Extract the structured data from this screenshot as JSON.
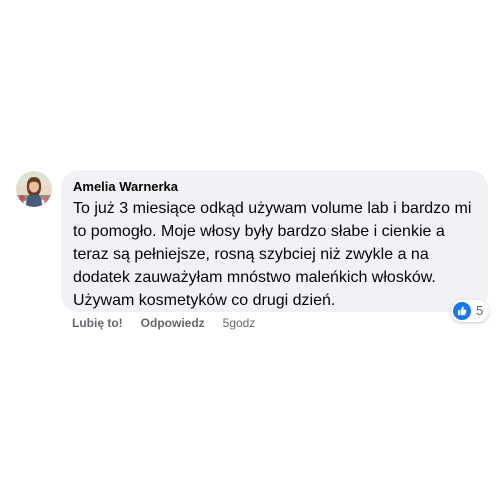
{
  "comment": {
    "author": "Amelia Warnerka",
    "text_lines": [
      "To już 3 miesiące odkąd używam volume lab i bardzo mi",
      "to pomogło. Moje włosy były bardzo słabe i cienkie a",
      "teraz są pełniejsze, rosną szybciej niż zwykle a na",
      "dodatek zauważyłam mnóstwo maleńkich włosków.",
      "Używam kosmetyków co drugi dzień."
    ],
    "reaction": {
      "icon": "like-icon",
      "count": "5"
    },
    "actions": {
      "like_label": "Lubię to!",
      "reply_label": "Odpowiedz",
      "timestamp": "5godz"
    }
  },
  "colors": {
    "bubble_bg": "#f0f2f5",
    "text": "#050505",
    "secondary_text": "#65676b",
    "like_blue": "#1877f2"
  }
}
